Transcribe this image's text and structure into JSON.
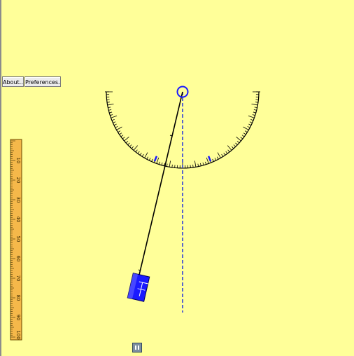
{
  "toolbar": {
    "about_label": "About...",
    "preferences_label": "Preferences..."
  },
  "ruler": {
    "labels": [
      "10",
      "20",
      "30",
      "40",
      "50",
      "60",
      "70",
      "80",
      "90",
      "100"
    ]
  },
  "controls": {
    "pause_icon": "pause-icon"
  },
  "colors": {
    "background": "#ffff99",
    "pendulum": "#1a1aff",
    "ruler": "#f5b84a",
    "protractor": "#000000"
  }
}
